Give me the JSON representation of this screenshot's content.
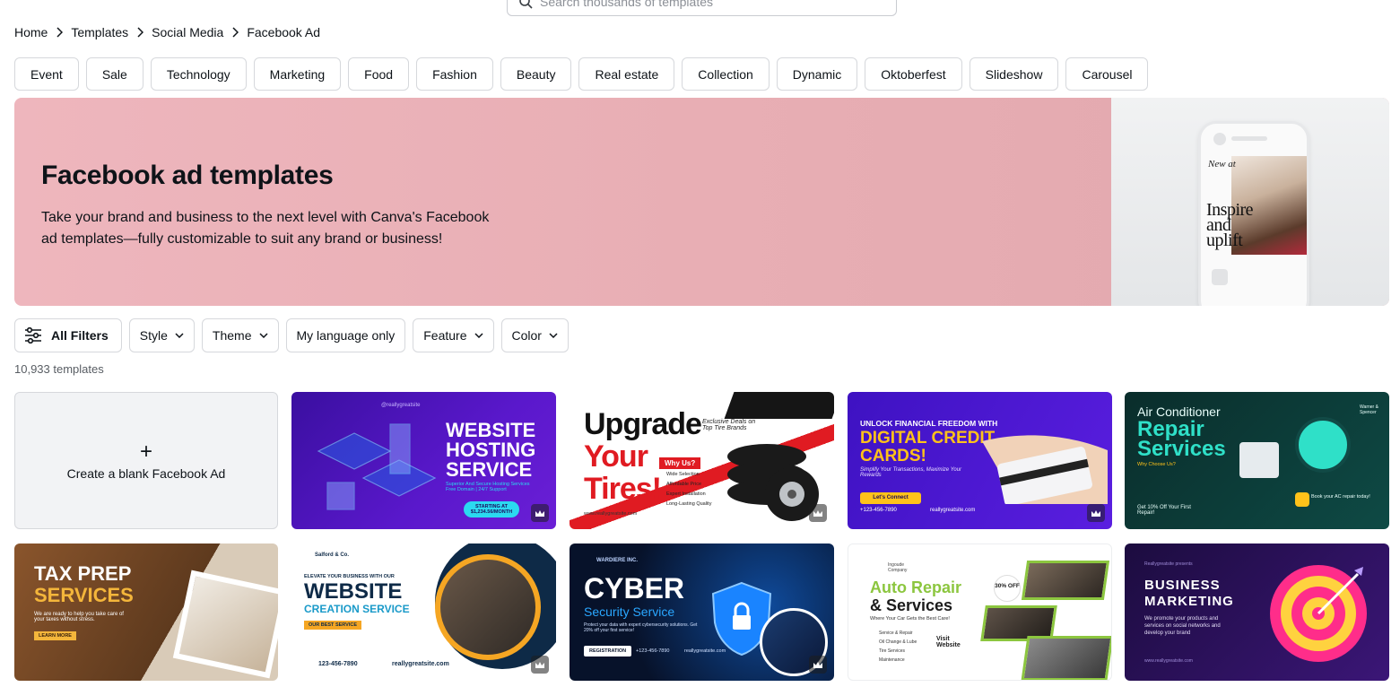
{
  "search": {
    "placeholder": "Search thousands of templates"
  },
  "breadcrumb": [
    {
      "label": "Home"
    },
    {
      "label": "Templates"
    },
    {
      "label": "Social Media"
    },
    {
      "label": "Facebook Ad"
    }
  ],
  "categories": [
    "Event",
    "Sale",
    "Technology",
    "Marketing",
    "Food",
    "Fashion",
    "Beauty",
    "Real estate",
    "Collection",
    "Dynamic",
    "Oktoberfest",
    "Slideshow",
    "Carousel"
  ],
  "hero": {
    "title": "Facebook ad templates",
    "description": "Take your brand and business to the next level with Canva's Facebook ad templates—fully customizable to suit any brand or business!",
    "art_new_at": "New at",
    "art_text": "Inspire and uplift"
  },
  "filters": {
    "all": "All Filters",
    "style": "Style",
    "theme": "Theme",
    "language": "My language only",
    "feature": "Feature",
    "color": "Color"
  },
  "result_count": "10,933 templates",
  "blank_card": {
    "plus": "+",
    "label": "Create a blank Facebook Ad"
  },
  "templates": [
    {
      "line1": "WEBSITE",
      "line2": "HOSTING",
      "line3": "SERVICE",
      "sub": "Superior And Secure Hosting Services Free Domain | 24/7 Support",
      "cta": "STARTING AT $1,234.56/MONTH",
      "brand": "@reallygreatsite",
      "colors": {
        "bg": "#4b12b8",
        "accent": "#2bd9f0"
      }
    },
    {
      "line1": "Upgrade",
      "line2": "Your",
      "line3": "Tires!",
      "sub": "Exclusive Deals on Top Tire Brands",
      "badge": "Why Us?",
      "bullets": [
        "Wide Selection",
        "Affordable Price",
        "Expert Installation",
        "Long-Lasting Quality"
      ],
      "footer": "www.reallygreatsite.com",
      "colors": {
        "bg": "#ffffff",
        "accent": "#e01b22"
      }
    },
    {
      "line1": "UNLOCK FINANCIAL FREEDOM WITH",
      "line2": "DIGITAL CREDIT",
      "line3": "CARDS!",
      "sub": "Simplify Your Transactions, Maximize Your Rewards",
      "cta": "Let's Connect",
      "phone": "+123-456-7890",
      "site": "reallygreatsite.com",
      "colors": {
        "bg": "#4d16d6",
        "accent": "#ffc21a"
      }
    },
    {
      "line1": "Air Conditioner",
      "line2": "Repair",
      "line3": "Services",
      "sub": "Why Choose Us?",
      "offer": "Get 10% Off Your First Repair!",
      "book": "Book your AC repair today!",
      "brand": "Warner & Spencer",
      "colors": {
        "bg": "#0b3d3a",
        "accent": "#2fe0c8"
      }
    },
    {
      "line1": "TAX PREP",
      "line2": "SERVICES",
      "sub": "We are ready to help you take care of your taxes without stress.",
      "cta": "LEARN MORE",
      "colors": {
        "bg": "#6b4226",
        "accent": "#f4b63b"
      }
    },
    {
      "brand": "Salford & Co.",
      "line0": "ELEVATE YOUR BUSINESS WITH OUR",
      "line1": "WEBSITE",
      "line2": "CREATION SERVICE",
      "badge": "OUR BEST SERVICE",
      "phone": "123-456-7890",
      "site": "reallygreatsite.com",
      "colors": {
        "bg": "#ffffff",
        "accent": "#1a9ac9"
      }
    },
    {
      "brand": "WARDIERE INC.",
      "line1": "CYBER",
      "line2": "Security Service",
      "sub": "Protect your data with expert cybersecurity solutions. Get 20% off your first service!",
      "cta": "REGISTRATION",
      "phone": "+123-456-7890",
      "site": "reallygreatsite.com",
      "colors": {
        "bg": "#07122a",
        "accent": "#2aa7ff"
      }
    },
    {
      "brand": "Ingoude Company",
      "line1": "Auto Repair",
      "line2": "& Services",
      "sub": "Where Your Car Gets the Best Care!",
      "badge": "30% OFF",
      "bullets": [
        "Service & Repair",
        "Oil Change & Lube",
        "Tire Services",
        "Maintenance"
      ],
      "cta": "Visit Website",
      "colors": {
        "bg": "#ffffff",
        "accent": "#8cc63f"
      }
    },
    {
      "brand": "Reallygreatsite presents",
      "line1": "BUSINESS",
      "line2": "MARKETING",
      "sub": "We promote your products and services on social networks and develop your brand",
      "site": "www.reallygreatsite.com",
      "colors": {
        "bg": "#2a1254",
        "accent": "#ff2d8a"
      }
    }
  ]
}
